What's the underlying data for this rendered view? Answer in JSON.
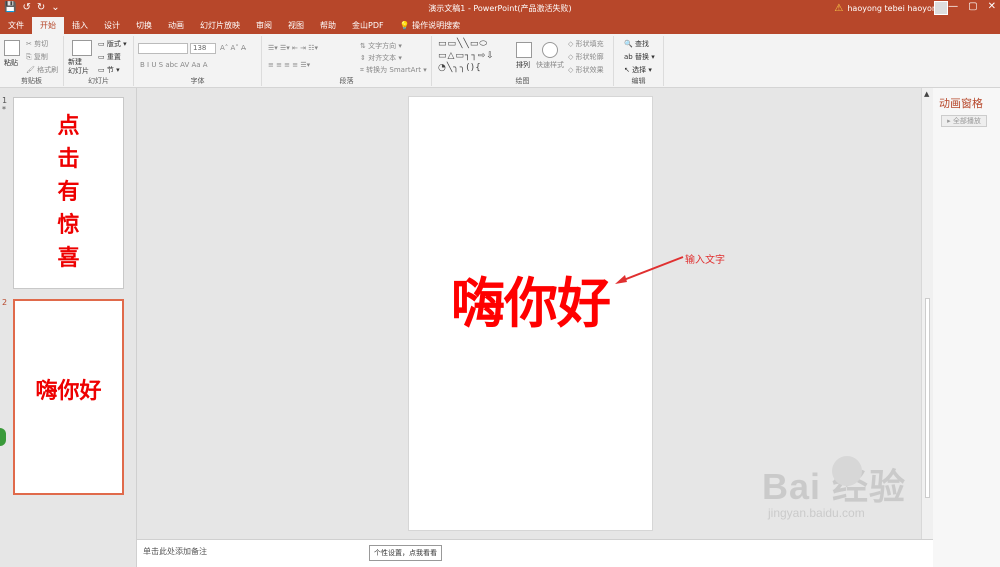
{
  "window": {
    "title": "演示文稿1  -  PowerPoint(产品激活失败)",
    "user": "haoyong tebei haoyong",
    "controls": [
      "—",
      "▢",
      "✕"
    ]
  },
  "qat": [
    "💾",
    "↺",
    "↻",
    "⌄"
  ],
  "tabs": [
    "文件",
    "开始",
    "插入",
    "设计",
    "切换",
    "动画",
    "幻灯片放映",
    "审阅",
    "视图",
    "帮助",
    "金山PDF",
    "操作说明搜索"
  ],
  "ribbon": {
    "clipboard": {
      "paste": "粘贴",
      "cut": "剪切",
      "copy": "复制",
      "format_painter": "格式刷",
      "label": "剪贴板"
    },
    "slides": {
      "new_slide": "新建\n幻灯片",
      "layout": "版式",
      "reset": "重置",
      "section": "节",
      "label": "幻灯片"
    },
    "font": {
      "size": "138",
      "label": "字体",
      "styles": "B  I  U  S  abc  AV  Aa  A"
    },
    "paragraph": {
      "text_direction": "文字方向",
      "align_text": "对齐文本",
      "smartart": "转换为 SmartArt",
      "label": "段落"
    },
    "drawing": {
      "arrange": "排列",
      "quick_styles": "快速样式",
      "fill": "形状填充",
      "outline": "形状轮廓",
      "effects": "形状效果",
      "label": "绘图"
    },
    "editing": {
      "find": "查找",
      "replace": "替换",
      "select": "选择",
      "label": "编辑"
    }
  },
  "thumbnails": [
    {
      "num": "1",
      "star": "*",
      "text": "点击有惊喜"
    },
    {
      "num": "2",
      "text": "嗨你好"
    }
  ],
  "slide": {
    "text": "嗨你好"
  },
  "annotation": "输入文字",
  "animation_pane": {
    "title": "动画窗格",
    "play_all": "全部播放"
  },
  "notes": {
    "placeholder": "单击此处添加备注"
  },
  "tooltip": "个性设置，点我看看",
  "watermark": {
    "brand": "Bai 经验",
    "url": "jingyan.baidu.com"
  },
  "colors": {
    "accent": "#b7472a",
    "slide_text": "#ff0000"
  }
}
